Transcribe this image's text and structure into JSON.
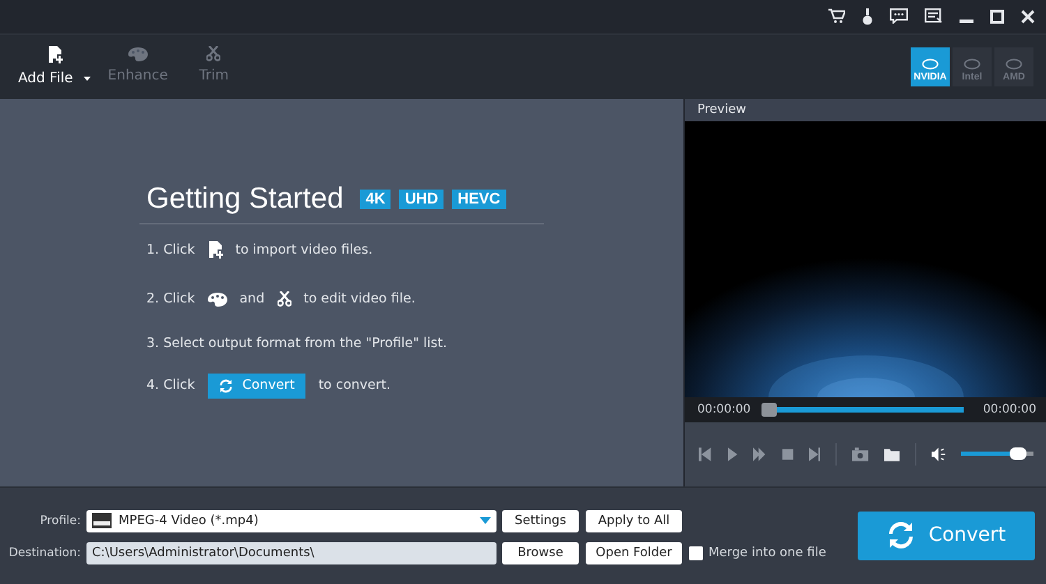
{
  "toolbar": [
    {
      "label": "Add File",
      "dropdown": true,
      "disabled": false
    },
    {
      "label": "Enhance",
      "dropdown": false,
      "disabled": true
    },
    {
      "label": "Trim",
      "dropdown": false,
      "disabled": true
    }
  ],
  "gpu": [
    {
      "label": "NVIDIA",
      "selected": true
    },
    {
      "label": "Intel",
      "selected": false
    },
    {
      "label": "AMD",
      "selected": false
    }
  ],
  "getting_started": {
    "title": "Getting Started",
    "badges": [
      "4K",
      "UHD",
      "HEVC"
    ],
    "steps": [
      [
        {
          "kind": "text",
          "text": "1. Click"
        },
        {
          "kind": "import"
        },
        {
          "kind": "text",
          "text": "to import video files."
        }
      ],
      [
        {
          "kind": "text",
          "text": "2. Click"
        },
        {
          "kind": "enhance"
        },
        {
          "kind": "text",
          "text": "and"
        },
        {
          "kind": "trim"
        },
        {
          "kind": "text",
          "text": "to edit video file."
        }
      ],
      [
        {
          "kind": "text",
          "text": "3. Select output format from the \"Profile\" list."
        }
      ],
      [
        {
          "kind": "text",
          "text": "4. Click"
        },
        {
          "kind": "button",
          "text": "Convert"
        },
        {
          "kind": "text",
          "text": "to convert."
        }
      ]
    ]
  },
  "preview": {
    "title": "Preview",
    "time_start": "00:00:00",
    "time_end": "00:00:00",
    "progress": {
      "level": 0
    },
    "volume": {
      "level": 0.85
    }
  },
  "profile": {
    "label": "Profile:",
    "value": "MPEG-4 Video (*.mp4)",
    "buttons": [
      "Settings",
      "Apply to All"
    ]
  },
  "destination": {
    "label": "Destination:",
    "value": "C:\\Users\\Administrator\\Documents\\",
    "buttons": [
      "Browse",
      "Open Folder"
    ]
  },
  "merge": {
    "label": "Merge into one file",
    "checked": false
  },
  "convert_button": "Convert"
}
